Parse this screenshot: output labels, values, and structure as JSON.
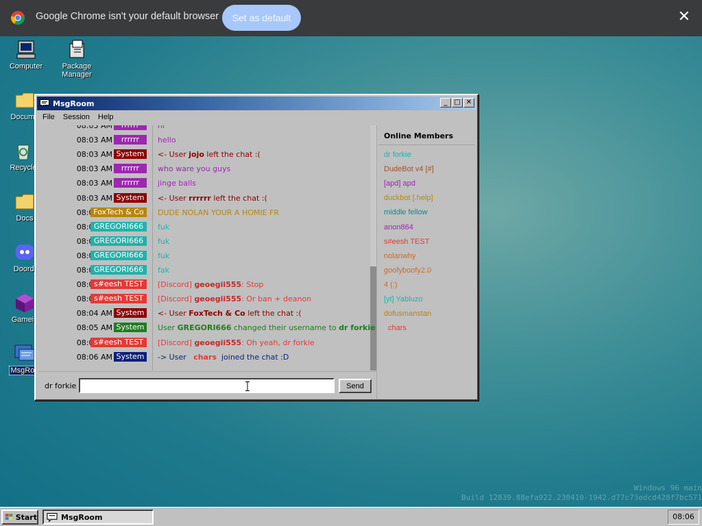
{
  "infobar": {
    "message": "Google Chrome isn't your default browser",
    "set_default_label": "Set as default",
    "close_glyph": "✕"
  },
  "desktop_icons": [
    {
      "label": "Computer",
      "icon": "computer-icon"
    },
    {
      "label": "Package Manager",
      "icon": "package-icon"
    },
    {
      "label": "Docume",
      "icon": "folder-icon"
    },
    {
      "label": "Recycle",
      "icon": "recycle-bin-icon"
    },
    {
      "label": "Docs",
      "icon": "folder-icon"
    },
    {
      "label": "Doordi",
      "icon": "discord-icon"
    },
    {
      "label": "Gamein",
      "icon": "cube-icon"
    },
    {
      "label": "MsgRoo",
      "icon": "msgroom-icon"
    }
  ],
  "window": {
    "title": "MsgRoom",
    "menu": [
      "File",
      "Session",
      "Help"
    ],
    "controls": [
      "_",
      "□",
      "✕"
    ]
  },
  "chat": {
    "messages": [
      {
        "time": "08:03 AM",
        "user": "rrrrrr",
        "badge_color": "#9c27b0",
        "text": "hi",
        "color": "#9c27b0",
        "partial": true
      },
      {
        "time": "08:03 AM",
        "user": "rrrrrr",
        "badge_color": "#9c27b0",
        "text": "hello",
        "color": "#9c27b0"
      },
      {
        "time": "08:03 AM",
        "user": "System",
        "badge_color": "#8b0000",
        "pre": "<- User ",
        "bold": "jojo",
        "post": " left the chat :(",
        "color": "#8b0000",
        "bold_color": "#8b0000"
      },
      {
        "time": "08:03 AM",
        "user": "rrrrrr",
        "badge_color": "#9c27b0",
        "text": "who ware you guys",
        "color": "#9c27b0"
      },
      {
        "time": "08:03 AM",
        "user": "rrrrrr",
        "badge_color": "#9c27b0",
        "text": "jinge balls",
        "color": "#9c27b0"
      },
      {
        "time": "08:03 AM",
        "user": "System",
        "badge_color": "#8b0000",
        "pre": "<- User ",
        "bold": "rrrrrr",
        "post": " left the chat :(",
        "color": "#8b0000",
        "bold_color": "#8b0000"
      },
      {
        "time": "08:03 AM",
        "user": "FoxTech & Co",
        "badge_color": "#b8860b",
        "text": "DUDE NOLAN YOUR A HOMIE FR",
        "color": "#b8860b"
      },
      {
        "time": "08:04 AM",
        "user": "GREGORI666",
        "badge_color": "#20b2aa",
        "text": "fuk",
        "color": "#20b2aa"
      },
      {
        "time": "08:04 AM",
        "user": "GREGORI666",
        "badge_color": "#20b2aa",
        "text": "fuk",
        "color": "#20b2aa"
      },
      {
        "time": "08:04 AM",
        "user": "GREGORI666",
        "badge_color": "#20b2aa",
        "text": "fuk",
        "color": "#20b2aa"
      },
      {
        "time": "08:04 AM",
        "user": "GREGORI666",
        "badge_color": "#20b2aa",
        "text": "fak",
        "color": "#20b2aa"
      },
      {
        "time": "08:04 AM",
        "user": "s#eesh TEST",
        "badge_color": "#e53935",
        "pre": "[Discord] ",
        "bold": "geoegii555",
        "post": ": Stop",
        "color": "#e53935",
        "bold_color": "#c62828"
      },
      {
        "time": "08:04 AM",
        "user": "s#eesh TEST",
        "badge_color": "#e53935",
        "pre": "[Discord] ",
        "bold": "geoegii555",
        "post": ": Or ban + deanon",
        "color": "#e53935",
        "bold_color": "#c62828"
      },
      {
        "time": "08:04 AM",
        "user": "System",
        "badge_color": "#8b0000",
        "pre": "<- User ",
        "bold": "FoxTech & Co",
        "post": " left the chat :(",
        "color": "#8b0000",
        "bold_color": "#8b0000"
      },
      {
        "time": "08:05 AM",
        "user": "System",
        "badge_color": "#1e7d1e",
        "pre": "User ",
        "bold": "GREGORI666",
        "post": " changed their username to ",
        "bold2": "dr forkie",
        "color": "#1e7d1e",
        "bold_color": "#1e7d1e"
      },
      {
        "time": "08:05 AM",
        "user": "s#eesh TEST",
        "badge_color": "#e53935",
        "pre": "[Discord] ",
        "bold": "geoegii555",
        "post": ": Oh yeah, dr forkie",
        "color": "#e53935",
        "bold_color": "#c62828"
      },
      {
        "time": "08:06 AM",
        "user": "System",
        "badge_color": "#0a1f7a",
        "pre": "-> User   ",
        "bold": "chars",
        "post": "  joined the chat :D",
        "color": "#0a1f7a",
        "bold_color": "#e53935"
      }
    ]
  },
  "members": {
    "title": "Online Members",
    "list": [
      {
        "name": "dr forkie",
        "color": "#20b2aa"
      },
      {
        "name": "DudeBot v4 [#]",
        "color": "#a0522d"
      },
      {
        "name": "[apd] apd",
        "color": "#9c27b0"
      },
      {
        "name": "duckbot [.help]",
        "color": "#b8860b"
      },
      {
        "name": "middle fellow",
        "color": "#0e8a8a"
      },
      {
        "name": "anon864",
        "color": "#9c27b0"
      },
      {
        "name": "s#eesh TEST",
        "color": "#e53935"
      },
      {
        "name": "nolanwhy",
        "color": "#d2691e"
      },
      {
        "name": "goofyboofy2.0",
        "color": "#d2691e"
      },
      {
        "name": "4 (:)",
        "color": "#d2691e"
      },
      {
        "name": "[yt] Yabluzo",
        "color": "#20b2aa"
      },
      {
        "name": "dofusmanstan",
        "color": "#b8860b"
      },
      {
        "name": "chars",
        "color": "#e53935"
      }
    ]
  },
  "input": {
    "nick": "dr forkie",
    "value": "",
    "send_label": "Send"
  },
  "watermark": {
    "line1": "Windows 96 main",
    "line2": "Build 12839.88efa922.230410-1942.d77c73edcd428f7bc571"
  },
  "taskbar": {
    "start_label": "Start",
    "task_label": "MsgRoom",
    "clock": "08:06"
  }
}
